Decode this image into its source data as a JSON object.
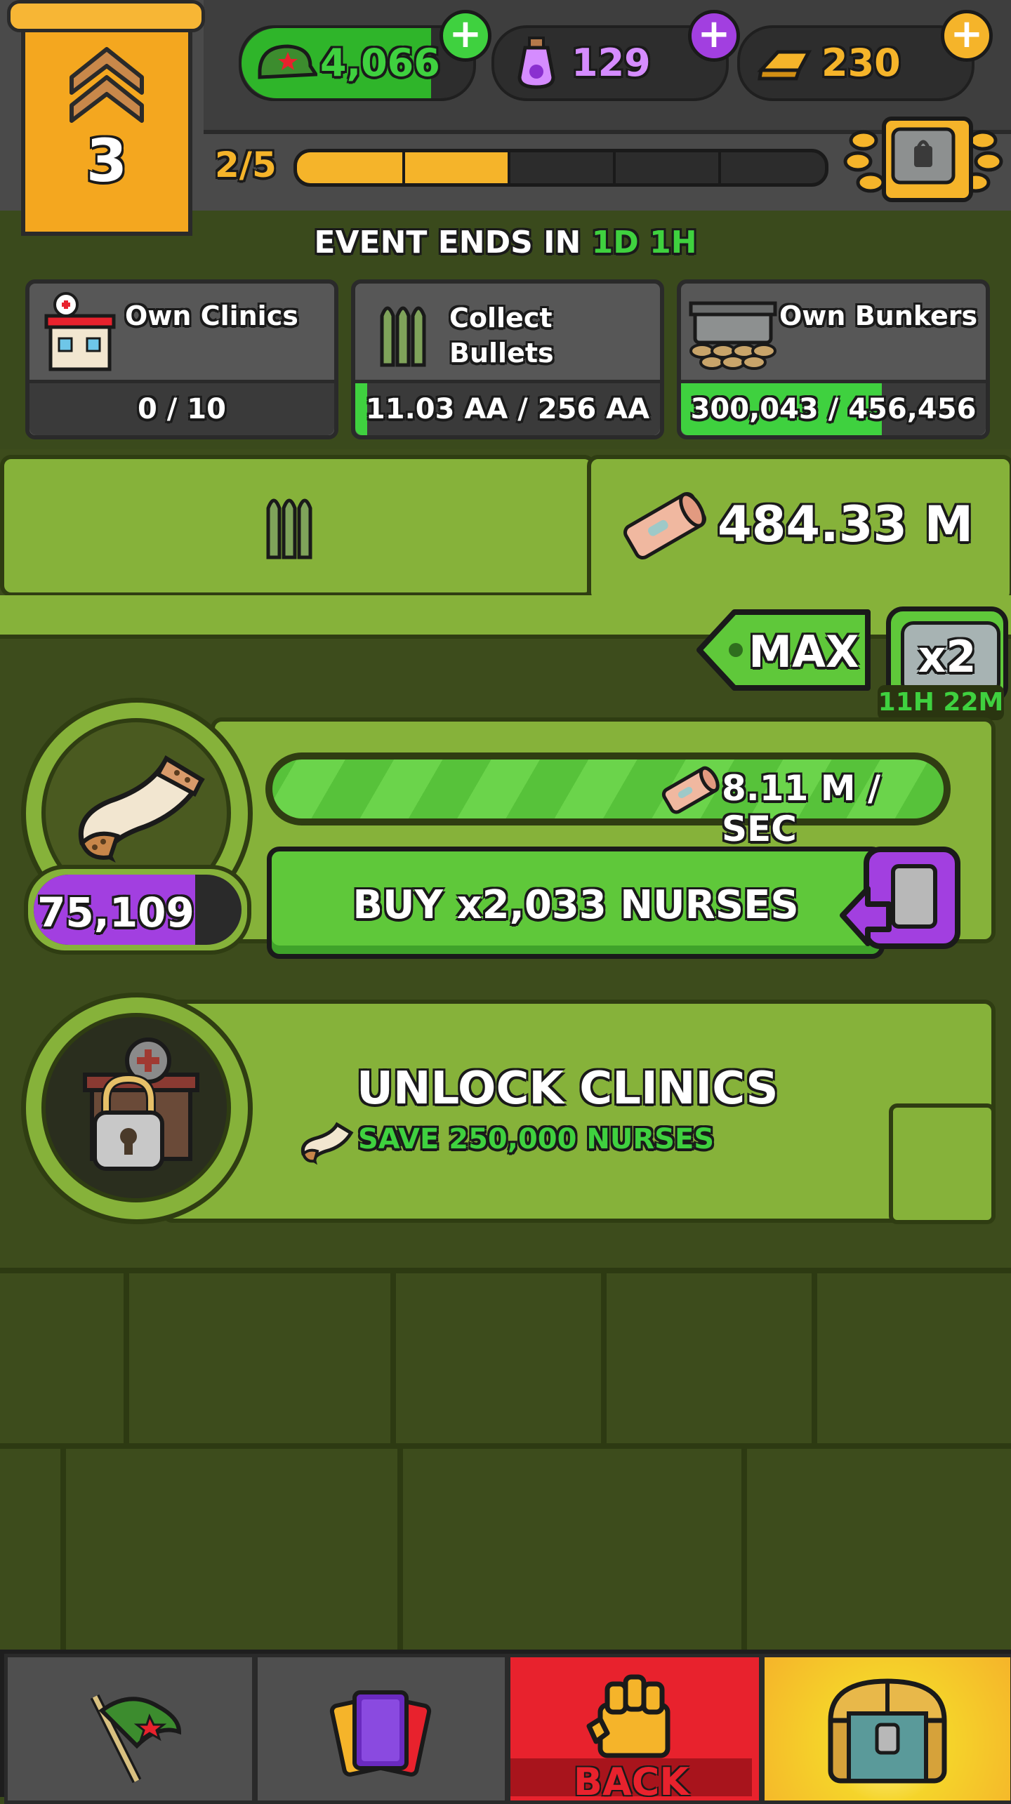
{
  "rank": {
    "level": "3"
  },
  "resources": [
    {
      "name": "cash",
      "icon": "army-cap-icon",
      "value": "4,066",
      "color": "#3fd13f"
    },
    {
      "name": "potion",
      "icon": "potion-icon",
      "value": "129",
      "color": "#c65bff"
    },
    {
      "name": "gold",
      "icon": "gold-bar-icon",
      "value": "230",
      "color": "#f5b42a"
    }
  ],
  "progress": {
    "label": "2/5",
    "fraction": 0.4
  },
  "event": {
    "prefix": "EVENT ENDS IN",
    "days": "1D",
    "hours": "1H"
  },
  "tasks": [
    {
      "title": "Own Clinics",
      "progress": "0 / 10",
      "fill": 0.0
    },
    {
      "title": "Collect Bullets",
      "progress": "11.03 AA / 256 AA",
      "fill": 0.04
    },
    {
      "title": "Own Bunkers",
      "progress": "300,043 / 456,456",
      "fill": 0.66
    }
  ],
  "bandage_total": "484.33 M",
  "max_button": "MAX",
  "multiplier": {
    "label": "x2",
    "timer": "11H 22M"
  },
  "nurses": {
    "rate": "8.11 M / SEC",
    "count": "75,109",
    "buy_label": "BUY x2,033 NURSES"
  },
  "unlock": {
    "title": "UNLOCK CLINICS",
    "requirement": "SAVE 250,000 NURSES"
  },
  "bottom_nav": {
    "back_label": "BACK"
  },
  "colors": {
    "green": "#3fd13f",
    "purple": "#a23fe0",
    "red": "#e8222d",
    "yellow": "#f5b42a"
  }
}
